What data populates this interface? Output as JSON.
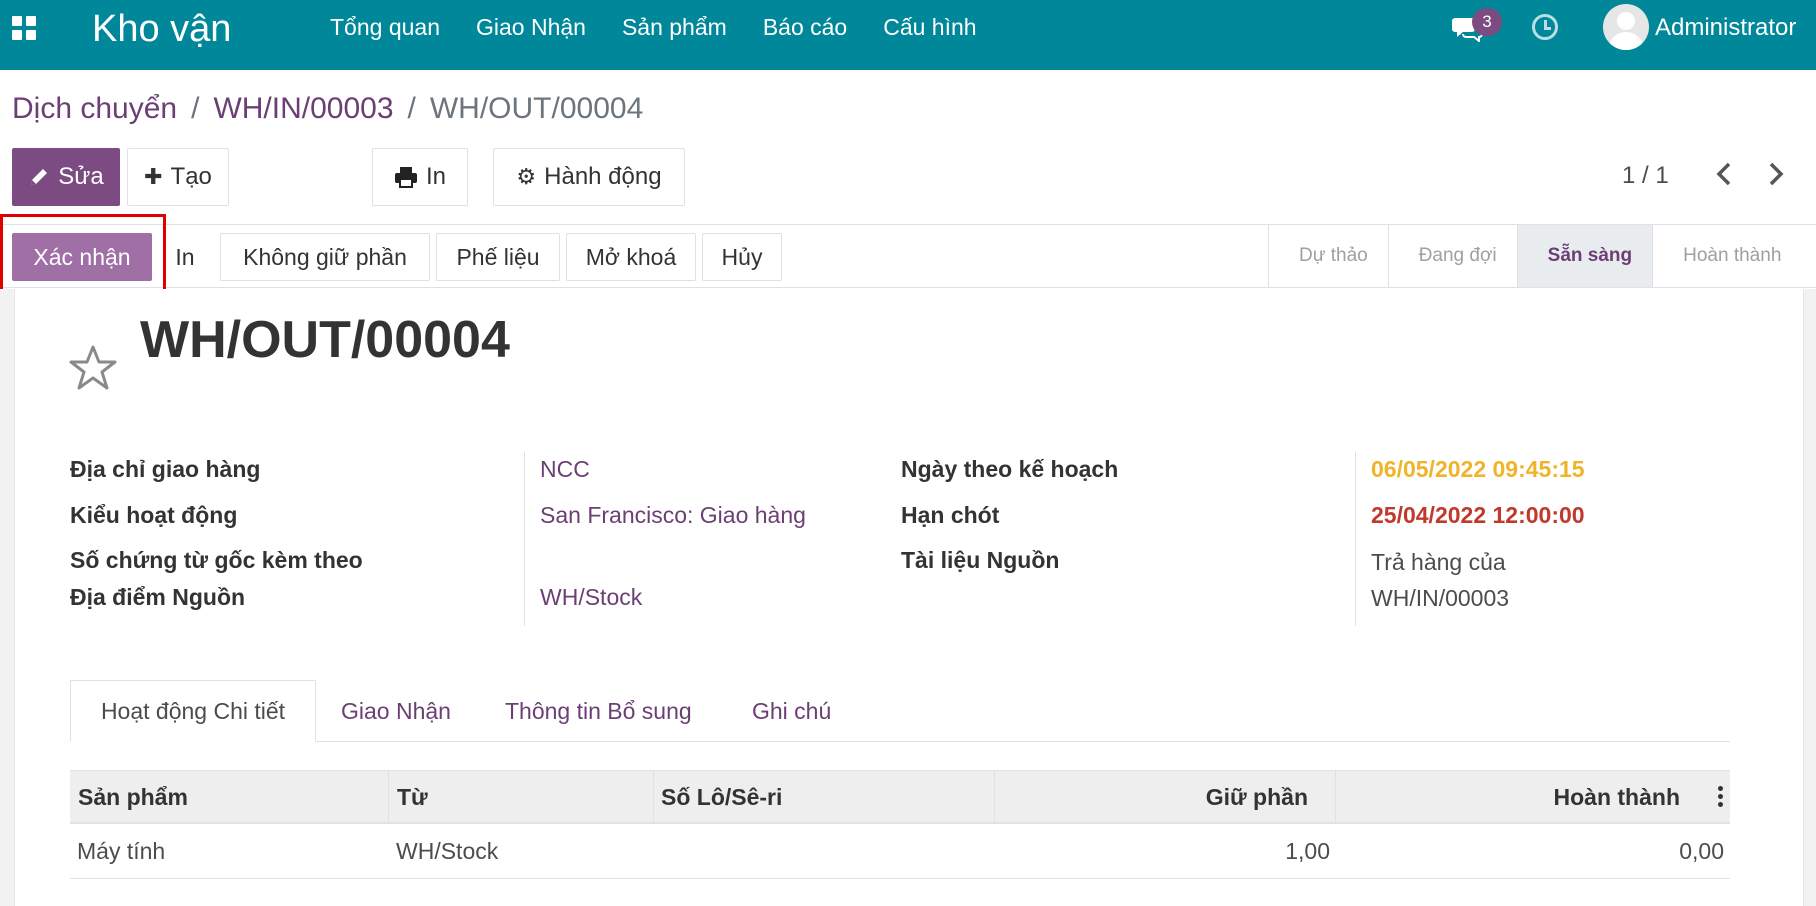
{
  "navbar": {
    "brand": "Kho vận",
    "menu": [
      "Tổng quan",
      "Giao Nhận",
      "Sản phẩm",
      "Báo cáo",
      "Cấu hình"
    ],
    "messages_count": "3",
    "user": "Administrator",
    "color": "#00889a"
  },
  "breadcrumb": {
    "root": "Dịch chuyển",
    "parent": "WH/IN/00003",
    "current": "WH/OUT/00004"
  },
  "toolbar": {
    "edit": "Sửa",
    "create": "Tạo",
    "print": "In",
    "action": "Hành động",
    "pager": "1 / 1"
  },
  "statusbar": {
    "buttons": [
      "Xác nhận",
      "In",
      "Không giữ phần",
      "Phế liệu",
      "Mở khoá",
      "Hủy"
    ],
    "stages": [
      "Dự thảo",
      "Đang đợi",
      "Sẵn sàng",
      "Hoàn thành"
    ],
    "active_stage": "Sẵn sàng"
  },
  "record": {
    "title": "WH/OUT/00004",
    "fields_left": [
      {
        "label": "Địa chỉ giao hàng",
        "value": "NCC"
      },
      {
        "label": "Kiểu hoạt động",
        "value": "San Francisco: Giao hàng"
      },
      {
        "label": "Số chứng từ gốc kèm theo",
        "value": ""
      },
      {
        "label": "Địa điểm Nguồn",
        "value": "WH/Stock"
      }
    ],
    "fields_right": [
      {
        "label": "Ngày theo kế hoạch",
        "value": "06/05/2022 09:45:15"
      },
      {
        "label": "Hạn chót",
        "value": "25/04/2022 12:00:00"
      },
      {
        "label": "Tài liệu Nguồn",
        "value": "Trả hàng của",
        "value2": "WH/IN/00003"
      }
    ]
  },
  "tabs": [
    "Hoạt động Chi tiết",
    "Giao Nhận",
    "Thông tin Bổ sung",
    "Ghi chú"
  ],
  "table": {
    "headers": [
      "Sản phẩm",
      "Từ",
      "Số Lô/Sê-ri",
      "Giữ phần",
      "Hoàn thành"
    ],
    "rows": [
      {
        "product": "Máy tính",
        "from": "WH/Stock",
        "lot": "",
        "reserved": "1,00",
        "done": "0,00"
      }
    ]
  },
  "colors": {
    "primary": "#7c4b81",
    "secondary_primary": "#a06fa6",
    "warning": "#f0b429",
    "danger": "#c0392b"
  }
}
